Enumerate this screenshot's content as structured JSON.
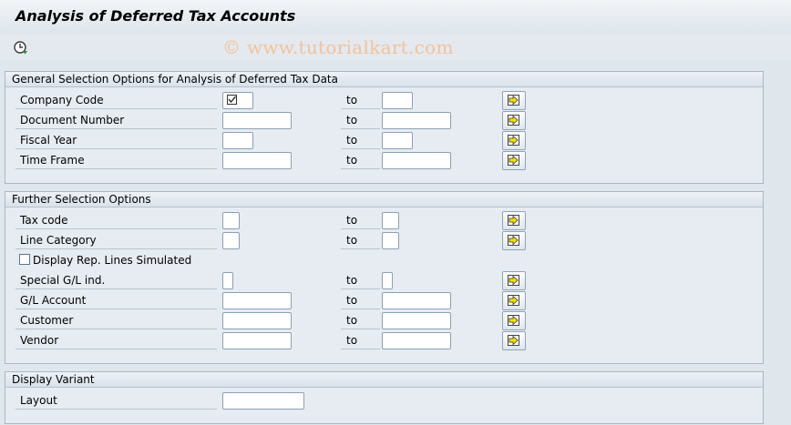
{
  "window": {
    "title": "Analysis of Deferred Tax Accounts"
  },
  "watermark": "© www.tutorialkart.com",
  "toolbar": {
    "execute_icon": "execute-clock-icon"
  },
  "groups": {
    "general": {
      "title": "General Selection Options for Analysis of Deferred Tax Data",
      "rows": {
        "company_code": {
          "label": "Company Code",
          "to": "to"
        },
        "document_number": {
          "label": "Document Number",
          "to": "to"
        },
        "fiscal_year": {
          "label": "Fiscal Year",
          "to": "to"
        },
        "time_frame": {
          "label": "Time Frame",
          "to": "to"
        }
      }
    },
    "further": {
      "title": "Further Selection Options",
      "rows": {
        "tax_code": {
          "label": "Tax code",
          "to": "to"
        },
        "line_category": {
          "label": "Line Category",
          "to": "to"
        },
        "display_rep": {
          "label": "Display Rep. Lines Simulated",
          "checked": false
        },
        "special_gl": {
          "label": "Special G/L ind.",
          "to": "to"
        },
        "gl_account": {
          "label": "G/L Account",
          "to": "to"
        },
        "customer": {
          "label": "Customer",
          "to": "to"
        },
        "vendor": {
          "label": "Vendor",
          "to": "to"
        }
      }
    },
    "display_variant": {
      "title": "Display Variant",
      "rows": {
        "layout": {
          "label": "Layout"
        }
      }
    }
  },
  "icons": {
    "multiple_selection": "multiple-selection-arrow-icon",
    "required_checkmark": "required-checkmark-icon"
  },
  "colors": {
    "arrow_fill": "#f5e100",
    "background": "#dfe6ec",
    "watermark": "#f2c29a"
  }
}
